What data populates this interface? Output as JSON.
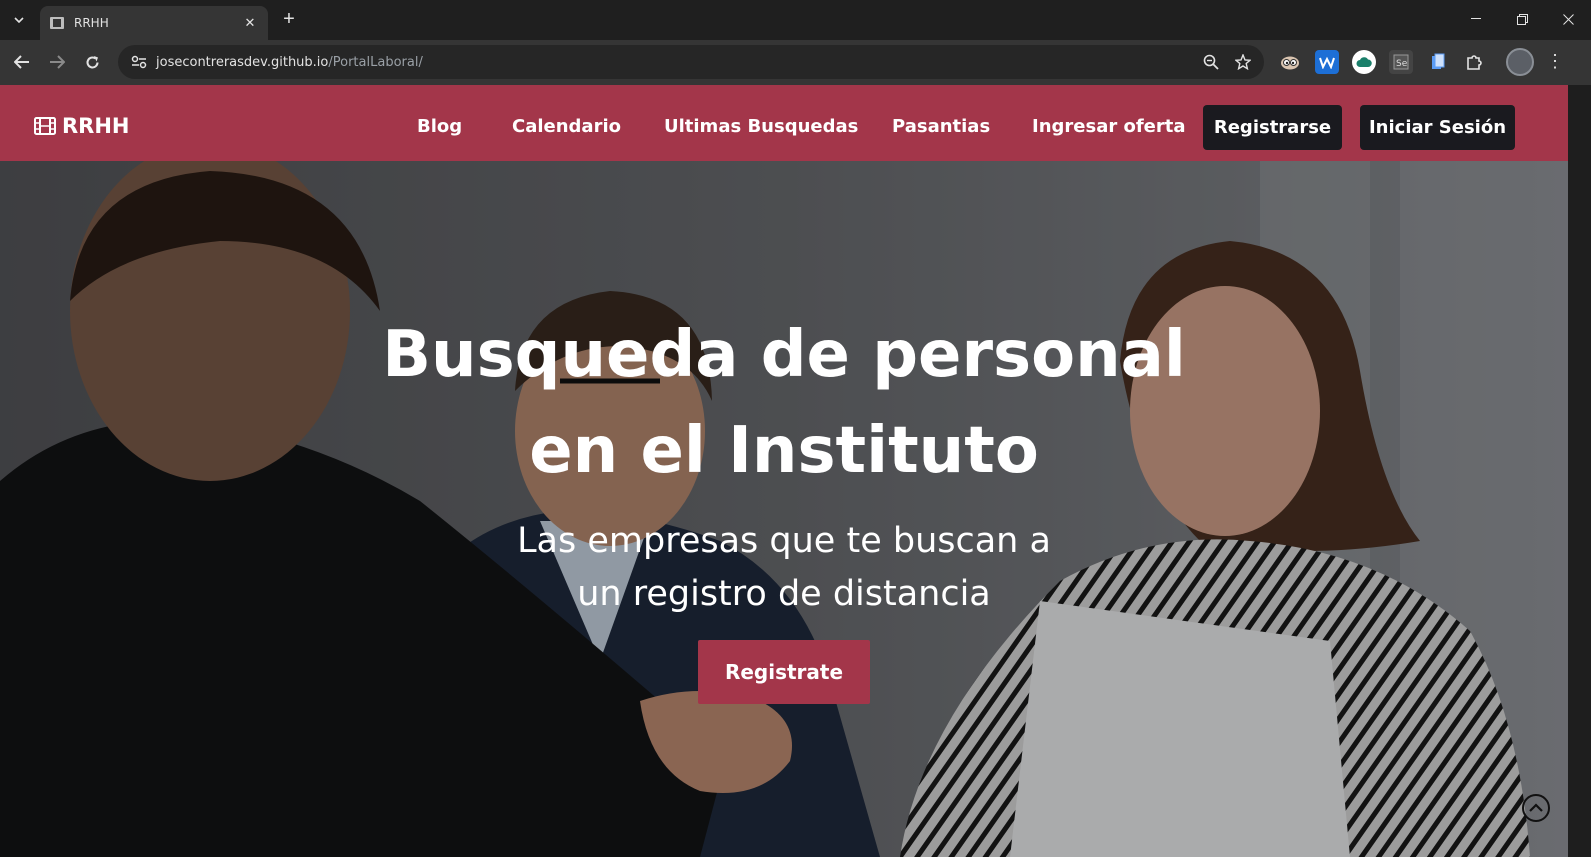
{
  "browser": {
    "tab_title": "RRHH",
    "url_host": "josecontrerasdev.github.io",
    "url_path": "/PortalLaboral/"
  },
  "site": {
    "brand": "RRHH",
    "nav": {
      "blog": "Blog",
      "calendario": "Calendario",
      "ultimas": "Ultimas Busquedas",
      "pasantias": "Pasantias",
      "ingresar": "Ingresar oferta",
      "registrarse": "Registrarse",
      "iniciar": "Iniciar Sesión"
    },
    "colors": {
      "brand": "#a3364a",
      "dark_button": "#1a1a1f"
    }
  },
  "hero": {
    "title_line1": "Busqueda de personal",
    "title_line2": "en el Instituto",
    "subtitle_line1": "Las empresas que te buscan a",
    "subtitle_line2": "un registro de distancia",
    "cta": "Registrate"
  },
  "icons": {
    "brand": "film-icon",
    "back_to_top": "chevron-up-circle-icon"
  }
}
